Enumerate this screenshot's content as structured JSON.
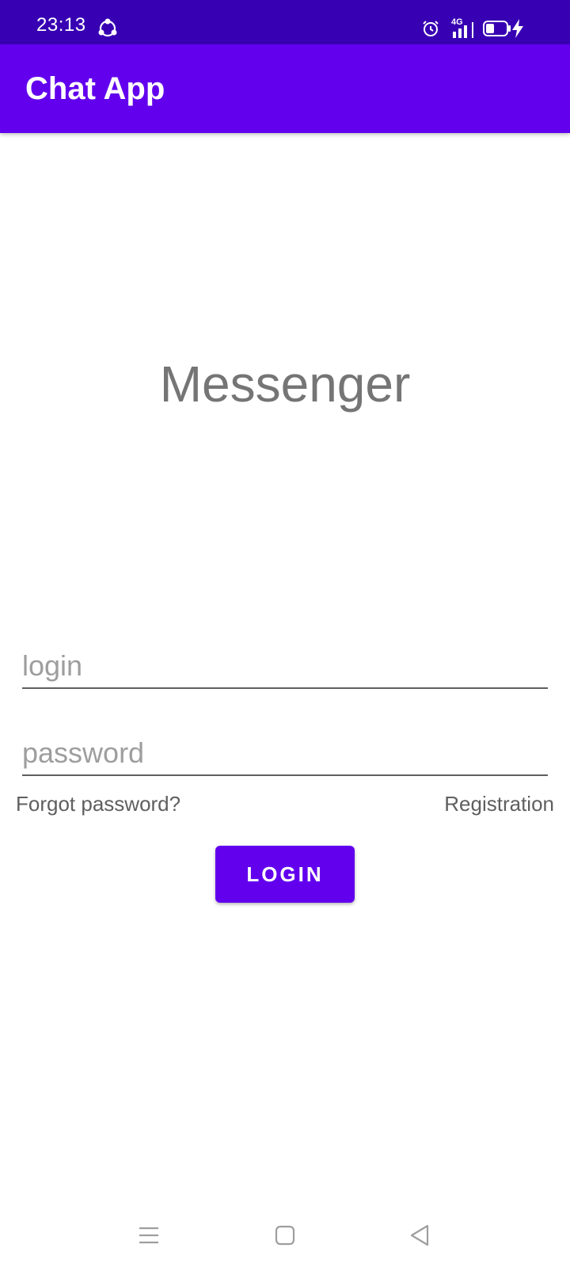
{
  "status_bar": {
    "time": "23:13",
    "network": "4G",
    "icons": [
      "sync-icon",
      "alarm-icon",
      "signal-icon",
      "battery-icon",
      "charging-icon"
    ]
  },
  "app_bar": {
    "title": "Chat App"
  },
  "main": {
    "heading": "Messenger",
    "login_field": {
      "placeholder": "login",
      "value": ""
    },
    "password_field": {
      "placeholder": "password",
      "value": ""
    },
    "forgot_password_link": "Forgot password?",
    "registration_link": "Registration",
    "login_button": "LOGIN"
  },
  "nav_bar": {
    "icons": [
      "menu-icon",
      "home-icon",
      "back-icon"
    ]
  },
  "colors": {
    "primary": "#6200ee",
    "primary_dark": "#3700b3",
    "heading_text": "#757575",
    "link_text": "#5f5f5f"
  }
}
